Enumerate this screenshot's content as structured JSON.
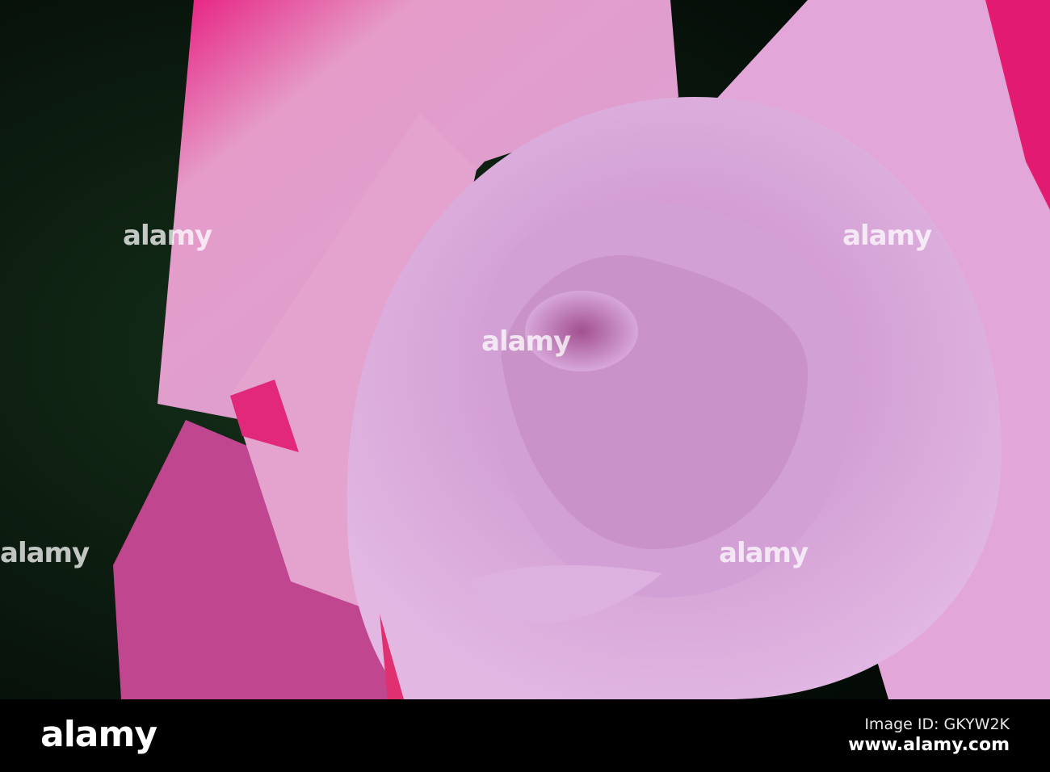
{
  "photo": {
    "subject": "pink-lavender rose close-up",
    "colors": {
      "background": "#0a1a0c",
      "petal": "#d9a3d6",
      "petal_shadow": "#b07ab8",
      "edge": "#e8156e"
    }
  },
  "watermark": {
    "text": "alamy"
  },
  "footer": {
    "logo": "alamy",
    "image_id": "Image ID: GKYW2K",
    "url": "www.alamy.com"
  }
}
